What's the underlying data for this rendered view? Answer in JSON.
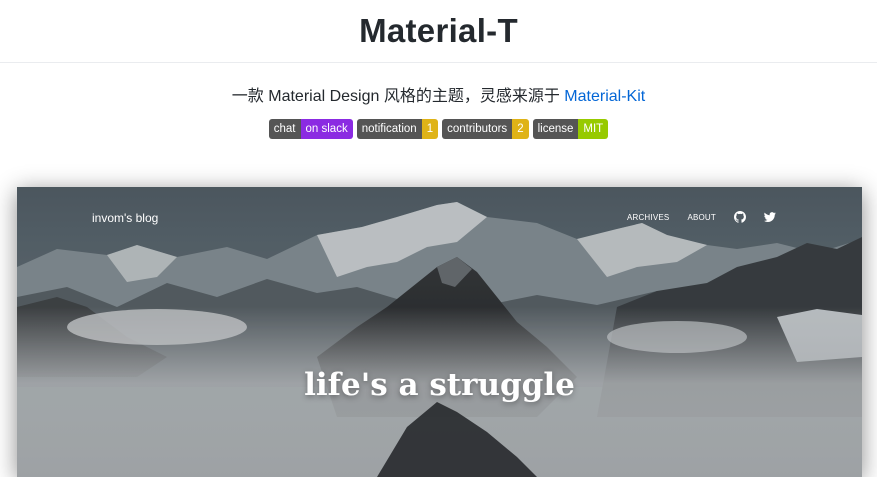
{
  "header": {
    "title": "Material-T"
  },
  "description": {
    "text": "一款 Material Design 风格的主题，灵感来源于 ",
    "link_text": "Material-Kit"
  },
  "badges": [
    {
      "left": "chat",
      "right": "on slack",
      "color": "#8b2be2"
    },
    {
      "left": "notification",
      "right": "1",
      "color": "#dfb317"
    },
    {
      "left": "contributors",
      "right": "2",
      "color": "#dfb317"
    },
    {
      "left": "license",
      "right": "MIT",
      "color": "#97ca00"
    }
  ],
  "preview": {
    "blog_name": "invom's blog",
    "nav": {
      "archives": "ARCHIVES",
      "about": "ABOUT",
      "github_icon": "github-icon",
      "twitter_icon": "twitter-icon"
    },
    "hero_text": "life's a struggle"
  },
  "colors": {
    "link": "#0366d6",
    "badge_label_bg": "#555555"
  }
}
